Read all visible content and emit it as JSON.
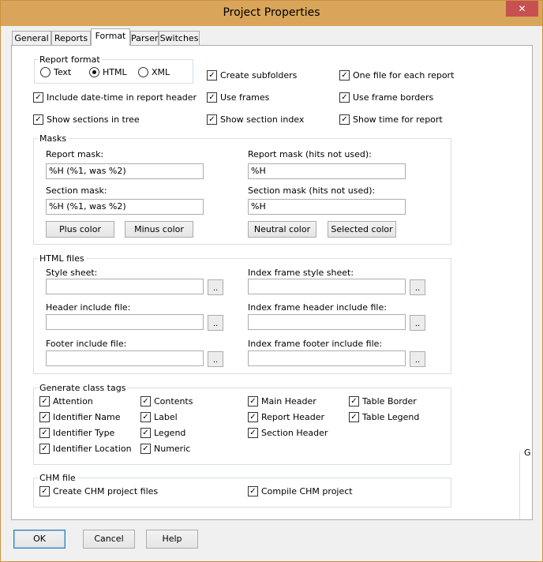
{
  "window": {
    "title": "Project Properties",
    "close_glyph": "✕"
  },
  "tabs": [
    "General",
    "Reports",
    "Format",
    "Parser",
    "Switches"
  ],
  "report_format": {
    "label": "Report format",
    "options": [
      "Text",
      "HTML",
      "XML"
    ],
    "selected": "HTML"
  },
  "checks": {
    "create_subfolders": "Create subfolders",
    "one_file": "One file for each report",
    "include_datetime": "Include date-time in report header",
    "use_frames": "Use frames",
    "use_frame_borders": "Use frame borders",
    "show_sections_tree": "Show sections in tree",
    "show_section_index": "Show section index",
    "show_time": "Show time for report"
  },
  "masks": {
    "label": "Masks",
    "report_mask_label": "Report mask:",
    "report_mask_value": "%H (%1, was %2)",
    "report_mask_nh_label": "Report mask (hits not used):",
    "report_mask_nh_value": "%H",
    "section_mask_label": "Section mask:",
    "section_mask_value": "%H (%1, was %2)",
    "section_mask_nh_label": "Section mask (hits not used):",
    "section_mask_nh_value": "%H",
    "plus_color": "Plus color",
    "minus_color": "Minus color",
    "neutral_color": "Neutral color",
    "selected_color": "Selected color"
  },
  "html_files": {
    "label": "HTML files",
    "style_sheet": "Style sheet:",
    "index_style_sheet": "Index frame style sheet:",
    "header_include": "Header include file:",
    "index_header_include": "Index frame header include file:",
    "footer_include": "Footer include file:",
    "index_footer_include": "Index frame footer include file:",
    "browse": ".."
  },
  "class_tags": {
    "label": "Generate class tags",
    "col1": [
      "Attention",
      "Identifier Name",
      "Identifier Type",
      "Identifier Location"
    ],
    "col2": [
      "Contents",
      "Label",
      "Legend",
      "Numeric"
    ],
    "col3": [
      "Main Header",
      "Report Header",
      "Section Header"
    ],
    "col4": [
      "Table Border",
      "Table Legend"
    ]
  },
  "chm": {
    "label": "CHM file",
    "create": "Create CHM project files",
    "compile": "Compile CHM project"
  },
  "buttons": {
    "ok": "OK",
    "cancel": "Cancel",
    "help": "Help"
  },
  "stray_label": "G"
}
